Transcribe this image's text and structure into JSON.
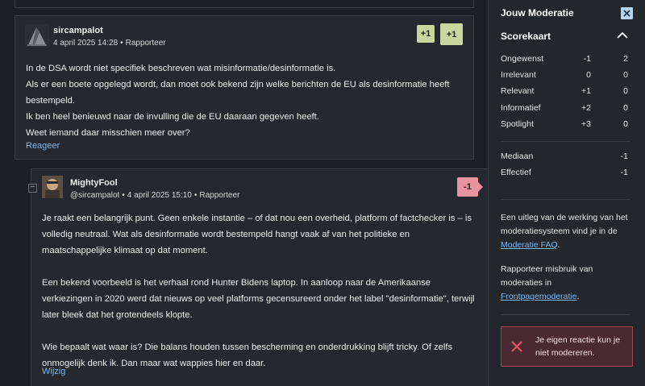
{
  "comments": [
    {
      "username": "sircampalot",
      "date": "4 april 2025 14:28",
      "report_label": "Rapporteer",
      "badge_small": "+1",
      "badge_big": "+1",
      "paragraphs": [
        "In de DSA wordt niet specifiek beschreven wat misinformatie/desinformatie is.\nAls er een boete opgelegd wordt, dan moet ook bekend zijn welke berichten de EU als desinformatie heeft bestempeld.\nIk ben heel benieuwd naar de invulling die de EU daaraan gegeven heeft.\nWeet iemand daar misschien meer over?"
      ],
      "action_label": "Reageer"
    },
    {
      "username": "MightyFool",
      "reply_to": "@sircampalot",
      "date": "4 april 2025 15:10",
      "report_label": "Rapporteer",
      "collapse_symbol": "−",
      "badge": "-1",
      "paragraphs": [
        "Je raakt een belangrijk punt. Geen enkele instantie – of dat nou een overheid, platform of factchecker is – is volledig neutraal. Wat als desinformatie wordt bestempeld hangt vaak af van het politieke en maatschappelijke klimaat op dat moment.",
        "Een bekend voorbeeld is het verhaal rond Hunter Bidens laptop. In aanloop naar de Amerikaanse verkiezingen in 2020 werd dat nieuws op veel platforms gecensureerd onder het label \"desinformatie\", terwijl later bleek dat het grotendeels klopte.",
        "Wie bepaalt wat waar is? Die balans houden tussen bescherming en onderdrukking blijft tricky. Of zelfs onmogelijk denk ik. Dan maar wat wappies hier en daar."
      ],
      "action_label": "Wijzig"
    }
  ],
  "panel": {
    "title": "Jouw Moderatie",
    "close_icon": "close-icon",
    "section_title": "Scorekaart",
    "scorecard": [
      {
        "label": "Ongewenst",
        "value": "-1",
        "count": "2"
      },
      {
        "label": "Irrelevant",
        "value": "0",
        "count": "0"
      },
      {
        "label": "Relevant",
        "value": "+1",
        "count": "0"
      },
      {
        "label": "Informatief",
        "value": "+2",
        "count": "0"
      },
      {
        "label": "Spotlight",
        "value": "+3",
        "count": "0"
      }
    ],
    "mediaan_label": "Mediaan",
    "mediaan_value": "-1",
    "effectief_label": "Effectief",
    "effectief_value": "-1",
    "info1_text": "Een uitleg van de werking van het moderatiesysteem vind je in de ",
    "info1_link": "Moderatie FAQ",
    "info1_end": ".",
    "info2_text": "Rapporteer misbruik van moderaties in ",
    "info2_link": "Frontpagemoderatie",
    "info2_end": ".",
    "alert_text": "Je eigen reactie kun je niet modereren."
  },
  "colors": {
    "background": "#1d1f24",
    "card": "#25282e",
    "link": "#7cb7ee",
    "positive_badge": "#c9d79e",
    "negative_badge": "#e8939f",
    "alert_border": "#a8434f"
  }
}
